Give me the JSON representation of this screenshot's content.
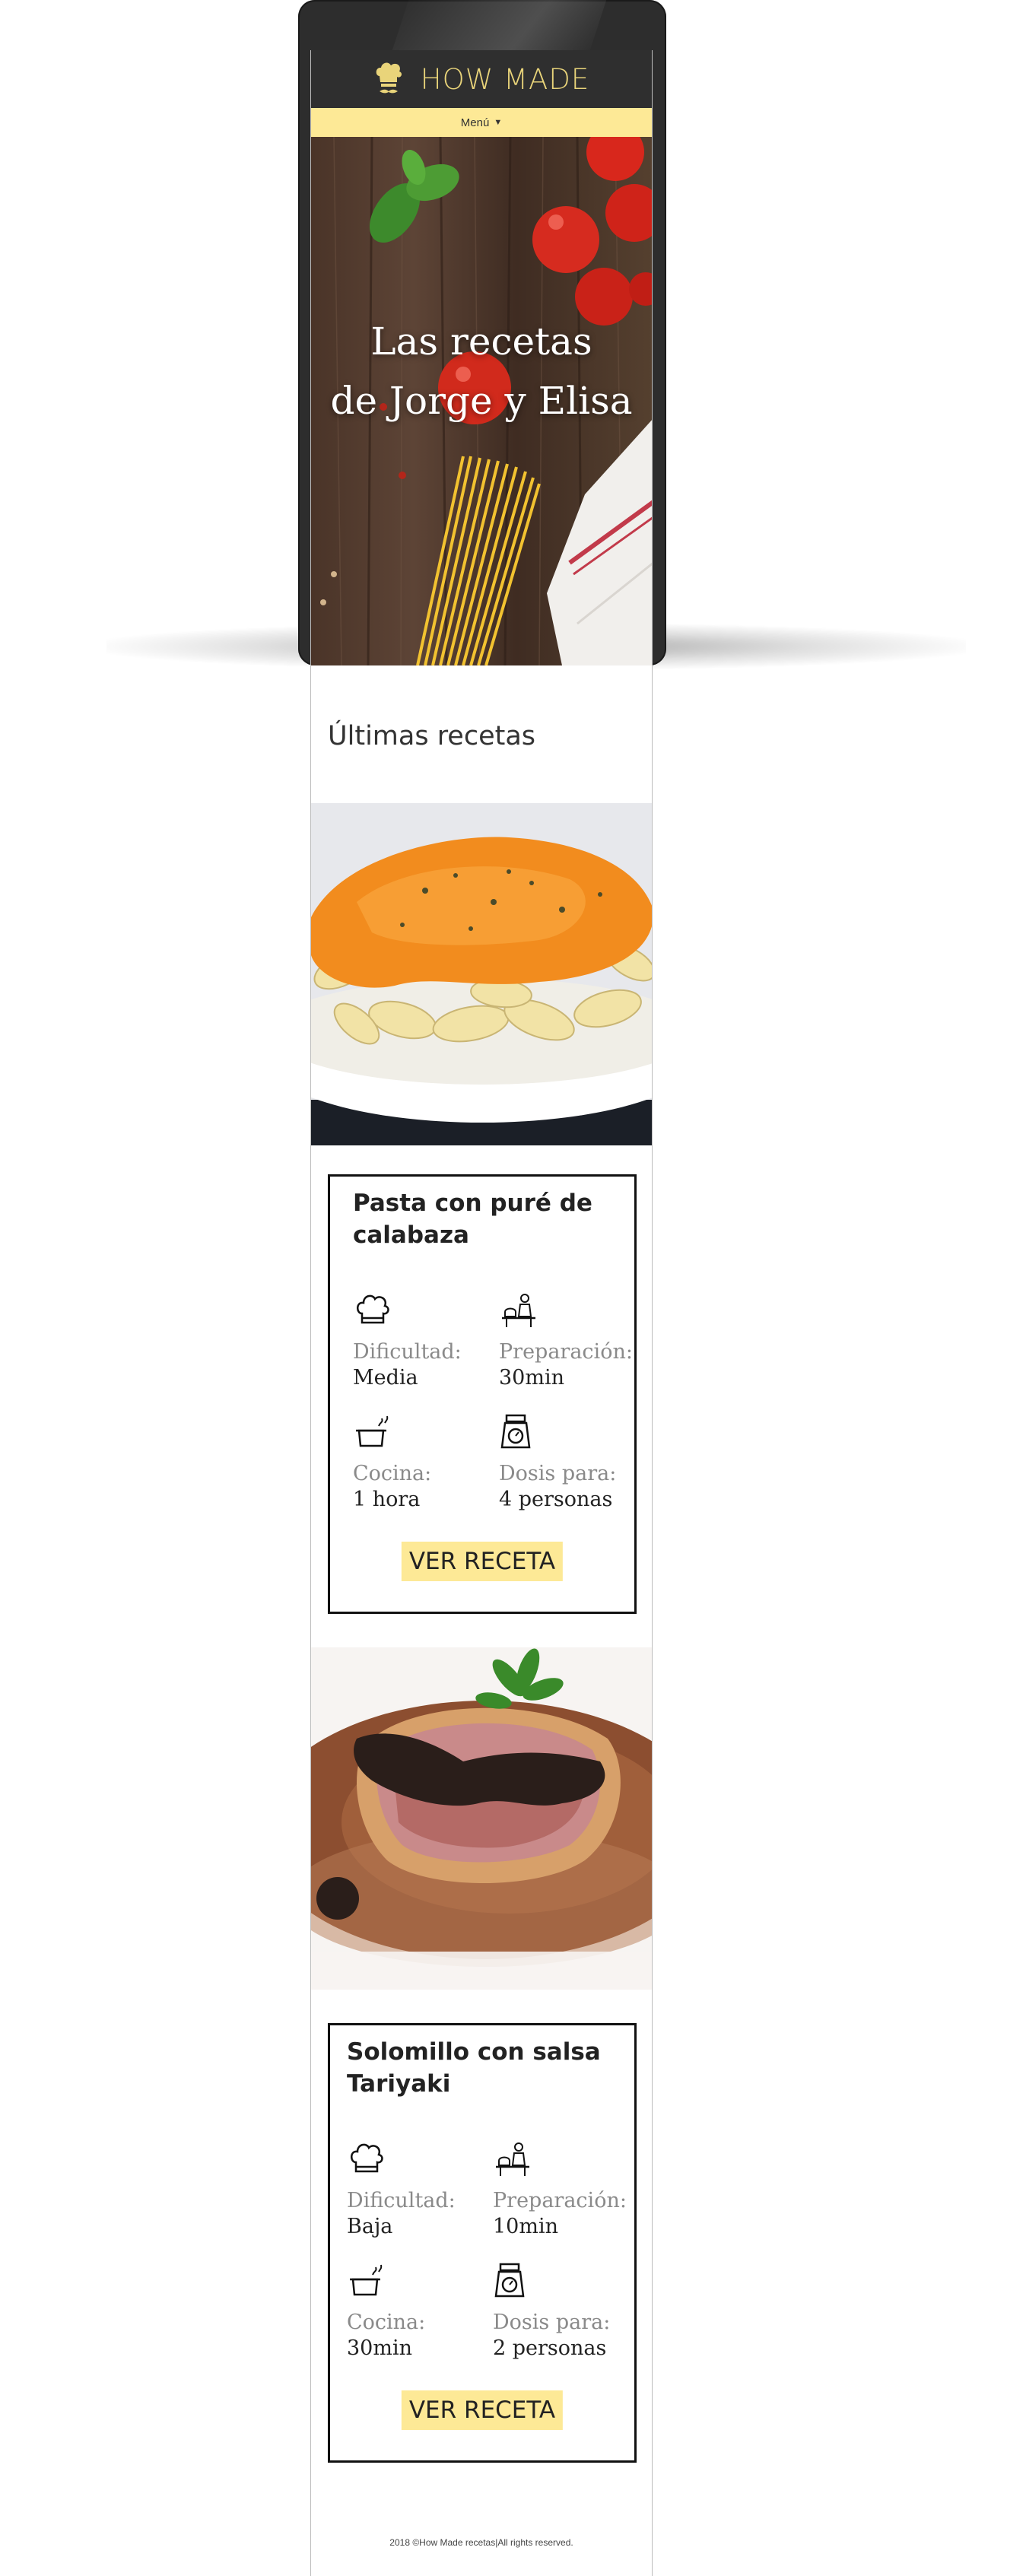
{
  "header": {
    "brand": "HOW MADE",
    "menu_label": "Menú",
    "hero_line1": "Las recetas",
    "hero_line2": "de Jorge y Elisa"
  },
  "section_title": "Últimas recetas",
  "recipes": [
    {
      "title": "Pasta con puré de calabaza",
      "difficulty_label": "Dificultad:",
      "difficulty": "Media",
      "prep_label": "Preparación:",
      "prep": "30min",
      "cook_label": "Cocina:",
      "cook": "1 hora",
      "servings_label": "Dosis para:",
      "servings": "4 personas",
      "button": "VER RECETA"
    },
    {
      "title": "Solomillo con salsa Tariyaki",
      "difficulty_label": "Dificultad:",
      "difficulty": "Baja",
      "prep_label": "Preparación:",
      "prep": "10min",
      "cook_label": "Cocina:",
      "cook": "30min",
      "servings_label": "Dosis para:",
      "servings": "2 personas",
      "button": "VER RECETA"
    }
  ],
  "footer": "2018 ©How Made recetas|All rights reserved.",
  "icons": {
    "logo": "chef-hat-icon",
    "difficulty": "chef-hat-icon",
    "prep": "cook-at-table-icon",
    "cook": "pot-icon",
    "servings": "kitchen-scale-icon"
  },
  "colors": {
    "accent": "#fde996",
    "brand_text": "#e9d47a",
    "header_bg": "#2f2f2f"
  }
}
